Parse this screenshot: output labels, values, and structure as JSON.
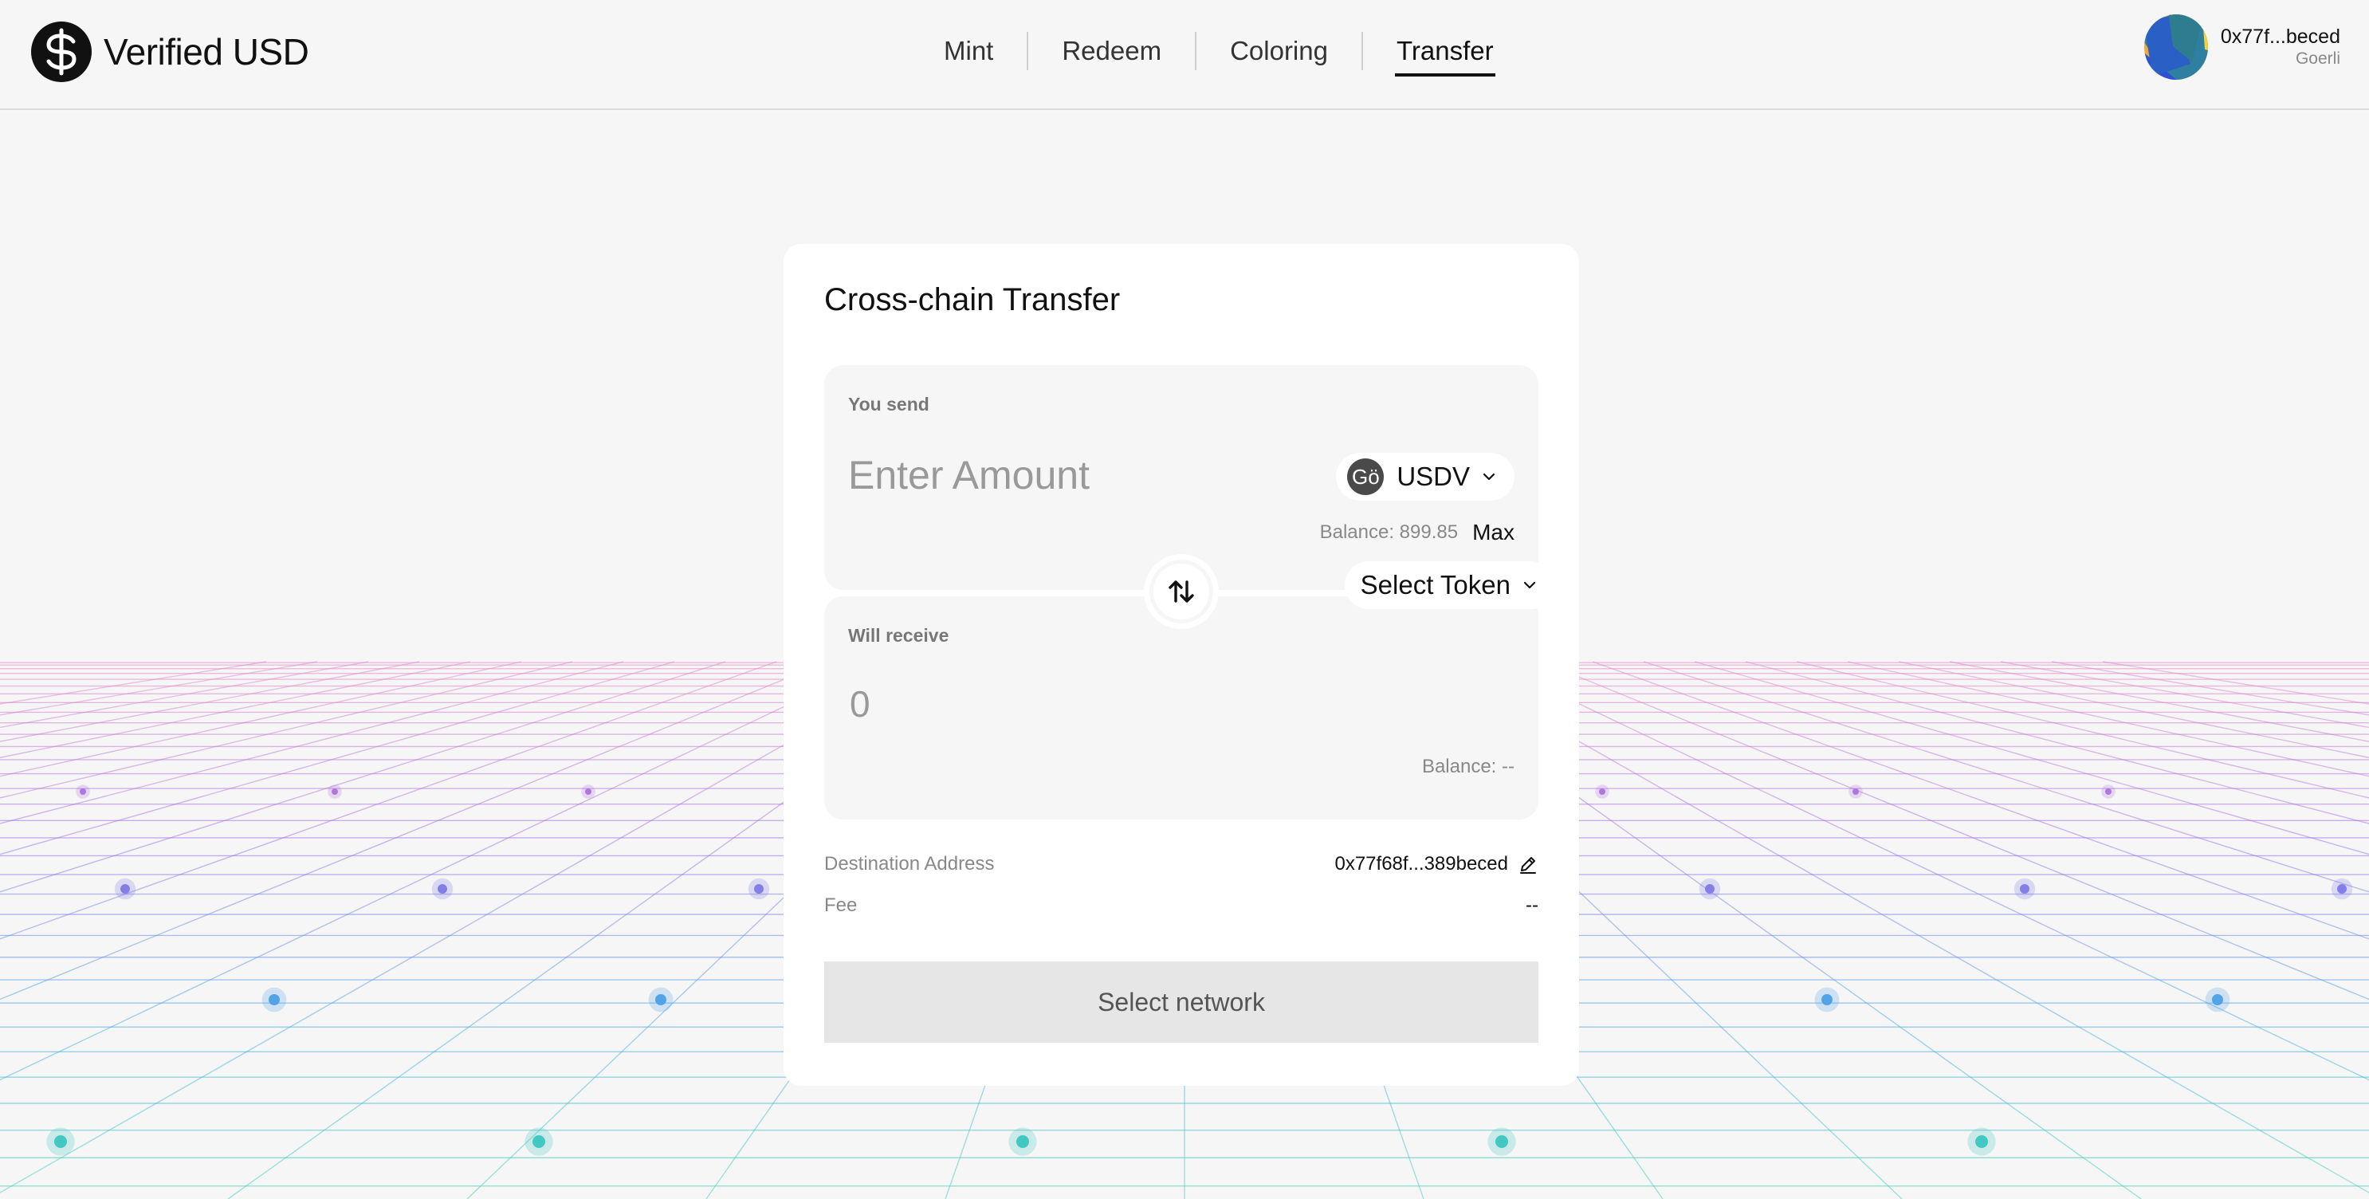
{
  "brand": {
    "name": "Verified USD",
    "logo_icon": "dollar-circle-icon"
  },
  "nav": {
    "items": [
      {
        "label": "Mint",
        "active": false
      },
      {
        "label": "Redeem",
        "active": false
      },
      {
        "label": "Coloring",
        "active": false
      },
      {
        "label": "Transfer",
        "active": true
      }
    ]
  },
  "account": {
    "address": "0x77f...beced",
    "network": "Goerli",
    "avatar_icon": "jazzicon-avatar"
  },
  "transfer": {
    "title": "Cross-chain Transfer",
    "send": {
      "label": "You send",
      "amount_placeholder": "Enter Amount",
      "amount_value": "",
      "token": {
        "symbol": "USDV",
        "icon_text": "Gö",
        "icon": "goerli-token-icon"
      },
      "balance": "Balance: 899.85",
      "max_label": "Max"
    },
    "swap_icon": "swap-arrows-icon",
    "receive": {
      "label": "Will receive",
      "amount": "0",
      "token_select_label": "Select Token",
      "balance": "Balance: --"
    },
    "destination": {
      "label": "Destination Address",
      "value": "0x77f68f...389beced",
      "edit_icon": "pencil-icon"
    },
    "fee": {
      "label": "Fee",
      "value": "--"
    },
    "submit_label": "Select network"
  },
  "colors": {
    "background": "#f6f6f6",
    "card": "#ffffff",
    "panel": "#f6f6f6",
    "disabled_button": "#e6e6e6",
    "grid_pink": "#e889c9",
    "grid_purple": "#9b6fe6",
    "grid_blue": "#4aa8e8",
    "grid_teal": "#3fd6b2"
  }
}
